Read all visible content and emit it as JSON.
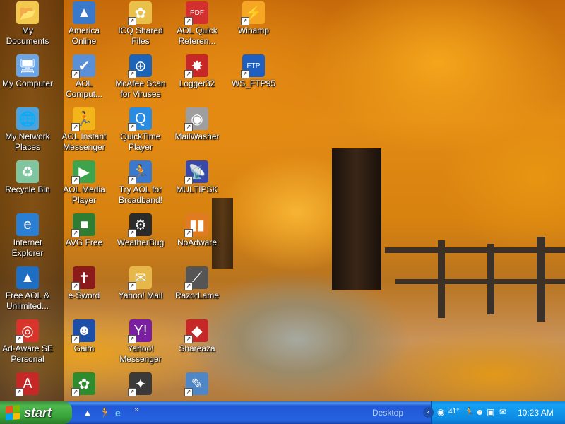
{
  "desktop_icons": [
    {
      "label": "My Documents",
      "icon": "folder-documents-icon",
      "color": "#f2c94c",
      "glyph": "📂",
      "shortcut": false
    },
    {
      "label": "My Computer",
      "icon": "computer-icon",
      "color": "#6aa5e8",
      "glyph": "🖥",
      "shortcut": false
    },
    {
      "label": "My Network Places",
      "icon": "network-icon",
      "color": "#4aa3df",
      "glyph": "🌐",
      "shortcut": false
    },
    {
      "label": "Recycle Bin",
      "icon": "recycle-bin-icon",
      "color": "#7fc6a0",
      "glyph": "♻",
      "shortcut": false
    },
    {
      "label": "Internet Explorer",
      "icon": "internet-explorer-icon",
      "color": "#2b7fd3",
      "glyph": "e",
      "shortcut": false
    },
    {
      "label": "Free AOL & Unlimited...",
      "icon": "aol-triangle-icon",
      "color": "#1e6fc4",
      "glyph": "▲",
      "shortcut": false
    },
    {
      "label": "Ad-Aware SE Personal",
      "icon": "ad-aware-icon",
      "color": "#d9342b",
      "glyph": "◎",
      "shortcut": true
    },
    {
      "label": "",
      "icon": "adobe-reader-icon",
      "color": "#c62828",
      "glyph": "A",
      "shortcut": true
    },
    {
      "label": "America Online",
      "icon": "aol-icon",
      "color": "#3a78c9",
      "glyph": "▲",
      "shortcut": false
    },
    {
      "label": "AOL Comput...",
      "icon": "aol-computer-check-icon",
      "color": "#5b8fd6",
      "glyph": "✔",
      "shortcut": true
    },
    {
      "label": "AOL Instant Messenger",
      "icon": "aim-running-man-icon",
      "color": "#f2b61b",
      "glyph": "🏃",
      "shortcut": true
    },
    {
      "label": "AOL Media Player",
      "icon": "aol-media-player-icon",
      "color": "#3fa34d",
      "glyph": "▶",
      "shortcut": true
    },
    {
      "label": "AVG Free",
      "icon": "avg-icon",
      "color": "#2e7d32",
      "glyph": "■",
      "shortcut": true
    },
    {
      "label": "e-Sword",
      "icon": "bible-icon",
      "color": "#8b1a1a",
      "glyph": "✝",
      "shortcut": true
    },
    {
      "label": "Gaim",
      "icon": "gaim-icon",
      "color": "#1e4fa8",
      "glyph": "☻",
      "shortcut": true
    },
    {
      "label": "",
      "icon": "icq-pro-icon",
      "color": "#2e8b2e",
      "glyph": "✿",
      "shortcut": true
    },
    {
      "label": "ICQ Shared Files",
      "icon": "icq-shared-files-icon",
      "color": "#e8c04a",
      "glyph": "✿",
      "shortcut": true
    },
    {
      "label": "McAfee Scan for Viruses",
      "icon": "mcafee-scan-icon",
      "color": "#1c64b8",
      "glyph": "⊕",
      "shortcut": true
    },
    {
      "label": "QuickTime Player",
      "icon": "quicktime-icon",
      "color": "#2a8be0",
      "glyph": "Q",
      "shortcut": true
    },
    {
      "label": "Try AOL for Broadband!",
      "icon": "aol-broadband-icon",
      "color": "#3b79cf",
      "glyph": "🏃",
      "shortcut": true
    },
    {
      "label": "WeatherBug",
      "icon": "weatherbug-icon",
      "color": "#2b2b2b",
      "glyph": "⚙",
      "shortcut": true
    },
    {
      "label": "Yahoo! Mail",
      "icon": "yahoo-mail-icon",
      "color": "#e6b84a",
      "glyph": "✉",
      "shortcut": true
    },
    {
      "label": "Yahoo! Messenger",
      "icon": "yahoo-messenger-icon",
      "color": "#7b1fa2",
      "glyph": "Y!",
      "shortcut": true
    },
    {
      "label": "",
      "icon": "bird-app-icon",
      "color": "#3a3a3a",
      "glyph": "✦",
      "shortcut": true
    },
    {
      "label": "AOL Quick Referen...",
      "icon": "pdf-document-icon",
      "color": "#d32f2f",
      "glyph": "PDF",
      "shortcut": true
    },
    {
      "label": "Logger32",
      "icon": "logger32-icon",
      "color": "#c62828",
      "glyph": "✸",
      "shortcut": true
    },
    {
      "label": "MailWasher",
      "icon": "mailwasher-icon",
      "color": "#9e9e9e",
      "glyph": "◉",
      "shortcut": true
    },
    {
      "label": "MULTIPSK",
      "icon": "multipsk-satellite-icon",
      "color": "#3949ab",
      "glyph": "📡",
      "shortcut": true
    },
    {
      "label": "NoAdware",
      "icon": "noadware-icon",
      "color": "#e07b22",
      "glyph": "▮▮",
      "shortcut": true
    },
    {
      "label": "RazorLame",
      "icon": "razorlame-icon",
      "color": "#555555",
      "glyph": "⟋",
      "shortcut": true
    },
    {
      "label": "Shareaza",
      "icon": "shareaza-icon",
      "color": "#c62828",
      "glyph": "◆",
      "shortcut": true
    },
    {
      "label": "",
      "icon": "document-edit-icon",
      "color": "#4f86c6",
      "glyph": "✎",
      "shortcut": true
    },
    {
      "label": "Winamp",
      "icon": "winamp-icon",
      "color": "#f5a623",
      "glyph": "⚡",
      "shortcut": true
    },
    {
      "label": "WS_FTP95",
      "icon": "ws-ftp-icon",
      "color": "#1f5fbf",
      "glyph": "FTP",
      "shortcut": true
    }
  ],
  "taskbar": {
    "start_label": "start",
    "quick_launch": [
      {
        "icon": "aol-quicklaunch-icon",
        "glyph": "▲"
      },
      {
        "icon": "aim-quicklaunch-icon",
        "glyph": "🏃"
      },
      {
        "icon": "ie-quicklaunch-icon",
        "glyph": "e"
      }
    ],
    "chevron": "»",
    "desktop_toolbar_label": "Desktop",
    "tray_icons": [
      {
        "icon": "tray-network-icon",
        "glyph": "◉"
      },
      {
        "icon": "tray-weather-icon",
        "glyph": "41°"
      },
      {
        "icon": "tray-aim-icon",
        "glyph": "🏃"
      },
      {
        "icon": "tray-messenger-icon",
        "glyph": "☻"
      },
      {
        "icon": "tray-monitor-icon",
        "glyph": "▣"
      },
      {
        "icon": "tray-mail-icon",
        "glyph": "✉"
      }
    ],
    "clock": "10:23 AM"
  },
  "colors": {
    "taskbar_blue": "#245edb",
    "start_green": "#3a9e3a",
    "tray_blue": "#0f8ae6"
  }
}
